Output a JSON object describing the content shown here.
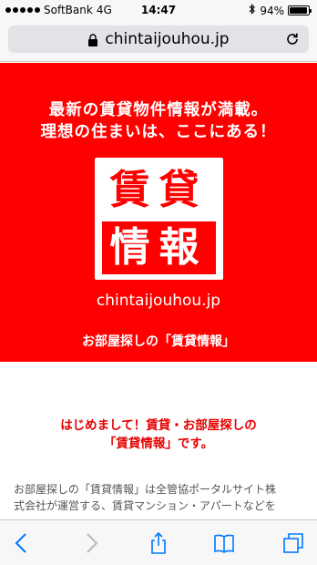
{
  "status_bar": {
    "carrier": "SoftBank",
    "network": "4G",
    "time": "14:47",
    "battery_percent": "94%",
    "battery_level": 0.94
  },
  "browser": {
    "url": "chintaijouhou.jp",
    "icons": [
      "lock-icon",
      "reload-icon"
    ]
  },
  "hero": {
    "headline_line1": "最新の賃貸物件情報が満載。",
    "headline_line2": "理想の住まいは、ここにある！",
    "logo_top": "賃貸",
    "logo_bottom": "情報",
    "domain": "chintaijouhou.jp",
    "subtitle": "お部屋探しの「賃貸情報」",
    "background_color": "#ff0000"
  },
  "intro": {
    "heading_line1": "はじめまして！賃貸・お部屋探しの",
    "heading_line2": "「賃貸情報」です。",
    "body_line1": "お部屋探しの「賃貸情報」は全管協ポータルサイト株",
    "body_line2": "式会社が運営する、賃貸マンション・アパートなどを"
  },
  "toolbar": {
    "icons": [
      "back-icon",
      "forward-icon",
      "share-icon",
      "bookmarks-icon",
      "tabs-icon"
    ],
    "accent_color": "#007aff"
  }
}
